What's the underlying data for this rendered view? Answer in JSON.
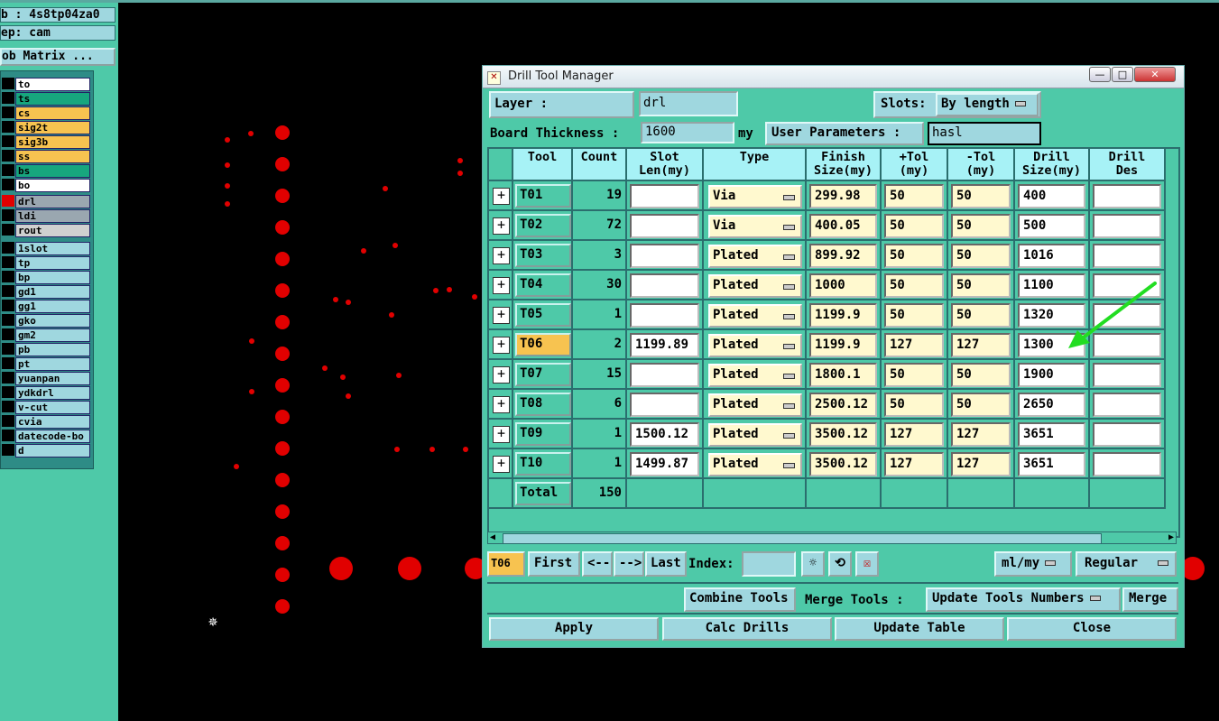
{
  "left_panel": {
    "job_field": "b : 4s8tp04za0",
    "step_field": "ep: cam",
    "matrix_button": "ob Matrix ...",
    "layers": [
      {
        "name": "to",
        "color": "#ffffff"
      },
      {
        "name": "ts",
        "color": "#17a67e"
      },
      {
        "name": "cs",
        "color": "#f7c350"
      },
      {
        "name": "sig2t",
        "color": "#f7c350"
      },
      {
        "name": "sig3b",
        "color": "#f7c350"
      },
      {
        "name": "ss",
        "color": "#f7c350"
      },
      {
        "name": "bs",
        "color": "#17a67e"
      },
      {
        "name": "bo",
        "color": "#ffffff"
      },
      {
        "name": "drl",
        "color": "#9aa7b0"
      },
      {
        "name": "ldi",
        "color": "#9aa7b0"
      },
      {
        "name": "rout",
        "color": "#d0d0d0"
      },
      {
        "name": "1slot",
        "color": "#9fd7df"
      },
      {
        "name": "tp",
        "color": "#9fd7df"
      },
      {
        "name": "bp",
        "color": "#9fd7df"
      },
      {
        "name": "gd1",
        "color": "#9fd7df"
      },
      {
        "name": "gg1",
        "color": "#9fd7df"
      },
      {
        "name": "gko",
        "color": "#9fd7df"
      },
      {
        "name": "gm2",
        "color": "#9fd7df"
      },
      {
        "name": "pb",
        "color": "#9fd7df"
      },
      {
        "name": "pt",
        "color": "#9fd7df"
      },
      {
        "name": "yuanpan",
        "color": "#9fd7df"
      },
      {
        "name": "ydkdrl",
        "color": "#9fd7df"
      },
      {
        "name": "v-cut",
        "color": "#9fd7df"
      },
      {
        "name": "cvia",
        "color": "#9fd7df"
      },
      {
        "name": "datecode-bo",
        "color": "#9fd7df"
      },
      {
        "name": "d",
        "color": "#9fd7df"
      }
    ]
  },
  "dialog": {
    "title": "Drill Tool Manager",
    "window_buttons": [
      "—",
      "□",
      "✕"
    ],
    "layer_label": "Layer          :",
    "layer_value": "drl",
    "slots_label": "Slots:",
    "slots_value": "By length",
    "board_thickness_label": "Board Thickness :",
    "board_thickness_value": "1600",
    "board_thickness_unit": "my",
    "user_params_label": "User Parameters :",
    "user_params_value": "hasl",
    "columns": [
      "Tool",
      "Count",
      "Slot\nLen(my)",
      "Type",
      "Finish\nSize(my)",
      "+Tol\n(my)",
      "-Tol\n(my)",
      "Drill\nSize(my)",
      "Drill\nDes"
    ],
    "rows": [
      {
        "tool": "T01",
        "count": "19",
        "slot_len": "",
        "type": "Via",
        "finish": "299.98",
        "ptol": "50",
        "ntol": "50",
        "drill": "400",
        "des": ""
      },
      {
        "tool": "T02",
        "count": "72",
        "slot_len": "",
        "type": "Via",
        "finish": "400.05",
        "ptol": "50",
        "ntol": "50",
        "drill": "500",
        "des": ""
      },
      {
        "tool": "T03",
        "count": "3",
        "slot_len": "",
        "type": "Plated",
        "finish": "899.92",
        "ptol": "50",
        "ntol": "50",
        "drill": "1016",
        "des": ""
      },
      {
        "tool": "T04",
        "count": "30",
        "slot_len": "",
        "type": "Plated",
        "finish": "1000",
        "ptol": "50",
        "ntol": "50",
        "drill": "1100",
        "des": ""
      },
      {
        "tool": "T05",
        "count": "1",
        "slot_len": "",
        "type": "Plated",
        "finish": "1199.9",
        "ptol": "50",
        "ntol": "50",
        "drill": "1320",
        "des": ""
      },
      {
        "tool": "T06",
        "count": "2",
        "slot_len": "1199.89",
        "type": "Plated",
        "finish": "1199.9",
        "ptol": "127",
        "ntol": "127",
        "drill": "1300",
        "des": "",
        "selected": true
      },
      {
        "tool": "T07",
        "count": "15",
        "slot_len": "",
        "type": "Plated",
        "finish": "1800.1",
        "ptol": "50",
        "ntol": "50",
        "drill": "1900",
        "des": ""
      },
      {
        "tool": "T08",
        "count": "6",
        "slot_len": "",
        "type": "Plated",
        "finish": "2500.12",
        "ptol": "50",
        "ntol": "50",
        "drill": "2650",
        "des": ""
      },
      {
        "tool": "T09",
        "count": "1",
        "slot_len": "1500.12",
        "type": "Plated",
        "finish": "3500.12",
        "ptol": "127",
        "ntol": "127",
        "drill": "3651",
        "des": ""
      },
      {
        "tool": "T10",
        "count": "1",
        "slot_len": "1499.87",
        "type": "Plated",
        "finish": "3500.12",
        "ptol": "127",
        "ntol": "127",
        "drill": "3651",
        "des": ""
      }
    ],
    "total_label": "Total",
    "total_count": "150",
    "nav": {
      "current": "T06",
      "first": "First",
      "prev": "<--",
      "next": "-->",
      "last": "Last",
      "index_label": "Index:",
      "index_value": "",
      "units": "ml/my",
      "mode": "Regular"
    },
    "combine_tools": "Combine Tools",
    "merge_tools_label": "Merge Tools :",
    "update_tools_numbers": "Update Tools Numbers",
    "merge": "Merge",
    "apply": "Apply",
    "calc_drills": "Calc Drills",
    "update_table": "Update Table",
    "close": "Close"
  },
  "colors": {
    "panel_bg": "#4ec9a8",
    "field_bg": "#9fd7df",
    "header_bg": "#a7f2f6",
    "selected_tool": "#f7c350",
    "drill_dot": "#e10000",
    "annotation_arrow": "#22dd22"
  }
}
